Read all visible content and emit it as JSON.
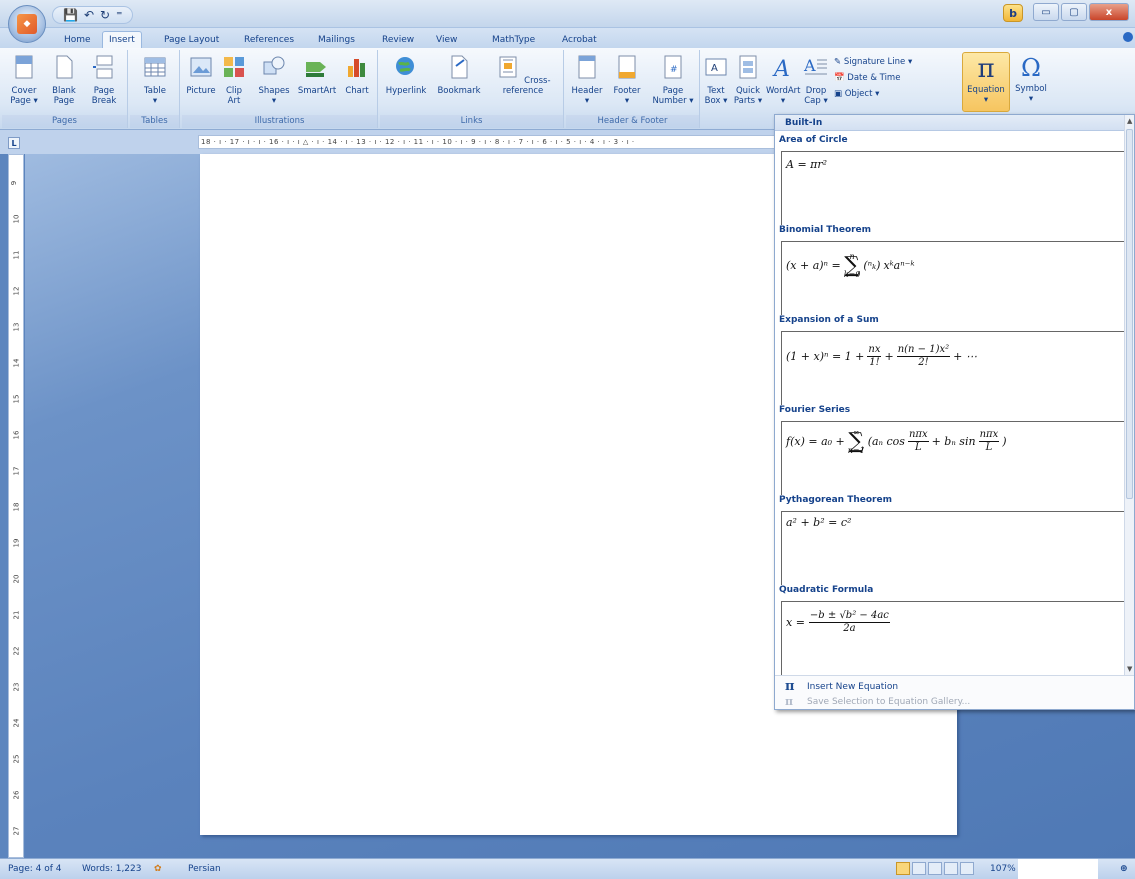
{
  "window": {
    "qat_icons": [
      "save-icon",
      "undo-icon",
      "redo-icon",
      "customize-icon"
    ],
    "controls": [
      "minimize",
      "restore",
      "close"
    ],
    "minimize_glyph": "▭",
    "restore_glyph": "▢",
    "close_glyph": "x",
    "bing_glyph": "b"
  },
  "tabs": [
    "Home",
    "Insert",
    "Page Layout",
    "References",
    "Mailings",
    "Review",
    "View",
    "MathType",
    "Acrobat"
  ],
  "active_tab": "Insert",
  "ribbon": {
    "groups": {
      "pages": "Pages",
      "tables": "Tables",
      "illustrations": "Illustrations",
      "links": "Links",
      "header_footer": "Header & Footer"
    },
    "buttons": {
      "cover_page": "Cover Page ▾",
      "blank_page": "Blank Page",
      "page_break": "Page Break",
      "table": "Table",
      "table_arrow": "▾",
      "picture": "Picture",
      "clip_art": "Clip Art",
      "shapes": "Shapes",
      "shapes_arrow": "▾",
      "smartart": "SmartArt",
      "chart": "Chart",
      "hyperlink": "Hyperlink",
      "bookmark": "Bookmark",
      "cross_reference": "Cross-reference",
      "header": "Header",
      "header_arrow": "▾",
      "footer": "Footer",
      "footer_arrow": "▾",
      "page_number": "Page Number ▾",
      "text_box": "Text Box ▾",
      "quick_parts": "Quick Parts ▾",
      "wordart": "WordArt",
      "wordart_arrow": "▾",
      "drop_cap": "Drop Cap ▾",
      "signature_line": "Signature Line ▾",
      "date_time": "Date & Time",
      "object": "Object ▾",
      "equation": "Equation",
      "equation_arrow": "▾",
      "symbol": "Symbol",
      "symbol_arrow": "▾"
    }
  },
  "ruler": {
    "corner": "L",
    "horizontal_labels": "18 · ı · 17 · ı · ı · 16 · ı · ı △ · ı · 14 · ı · 13 · ı · 12 · ı · 11 · ı · 10 · ı · 9 · ı · 8 · ı · 7 · ı · 6 · ı · 5 · ı · 4 · ı · 3 · ı ·",
    "vertical_labels": [
      "9",
      "10",
      "11",
      "12",
      "13",
      "14",
      "15",
      "16",
      "17",
      "18",
      "19",
      "20",
      "21",
      "22",
      "23",
      "24",
      "25",
      "26",
      "27"
    ]
  },
  "gallery": {
    "header": "Built-In",
    "entries": [
      {
        "title": "Area of Circle"
      },
      {
        "title": "Binomial Theorem"
      },
      {
        "title": "Expansion of a Sum"
      },
      {
        "title": "Fourier Series"
      },
      {
        "title": "Pythagorean Theorem"
      },
      {
        "title": "Quadratic Formula"
      }
    ],
    "formulas": {
      "area": "A = πr²",
      "binomial_lhs": "(x + a)ⁿ =",
      "binomial_sum_top": "n",
      "binomial_sum": "∑",
      "binomial_sum_bottom": "k=0",
      "binomial_choose": "(ⁿₖ)",
      "binomial_rest": "xᵏaⁿ⁻ᵏ",
      "expansion_lhs": "(1 + x)ⁿ = 1 +",
      "expansion_frac1_num": "nx",
      "expansion_frac1_den": "1!",
      "expansion_plus": "+",
      "expansion_frac2_num": "n(n − 1)x²",
      "expansion_frac2_den": "2!",
      "expansion_tail": "+ ⋯",
      "fourier_lhs": "f(x) = a₀ +",
      "fourier_sum_top": "∞",
      "fourier_sum": "∑",
      "fourier_sum_bottom": "n=1",
      "fourier_open": "(aₙ cos",
      "fourier_frac_num": "nπx",
      "fourier_frac_den": "L",
      "fourier_mid": "+ bₙ sin",
      "fourier_close": ")",
      "pythagorean": "a² + b² = c²",
      "quadratic_lhs": "x =",
      "quadratic_num": "−b ± √b² − 4ac",
      "quadratic_den": "2a"
    },
    "footer": {
      "insert_new_icon": "π",
      "insert_new": "Insert New Equation",
      "save_selection_icon": "π",
      "save_selection": "Save Selection to Equation Gallery..."
    },
    "scroll_up": "▲",
    "scroll_down": "▼"
  },
  "status": {
    "page": "Page: 4 of 4",
    "words": "Words: 1,223",
    "language": "Persian",
    "zoom": "107%"
  },
  "colors": {
    "accent": "#15428b",
    "workspace": "#5c85be",
    "ribbon": "#dbe7f5"
  }
}
